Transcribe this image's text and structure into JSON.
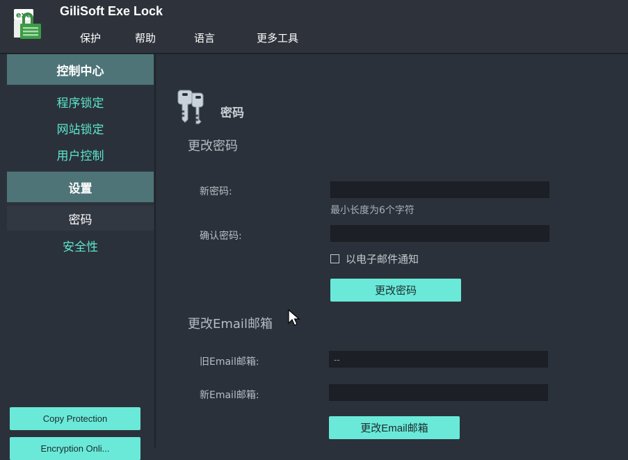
{
  "app": {
    "title": "GiliSoft Exe Lock",
    "logo_text": "exe"
  },
  "menu": {
    "items": [
      "保护",
      "帮助",
      "语言",
      "更多工具"
    ]
  },
  "sidebar": {
    "header_control": "控制中心",
    "control_items": [
      "程序锁定",
      "网站锁定",
      "用户控制"
    ],
    "header_settings": "设置",
    "settings_items": [
      "密码",
      "安全性"
    ],
    "bottom_buttons": [
      "Copy Protection",
      "Encryption Onli..."
    ]
  },
  "main": {
    "page_title": "密码",
    "password_section": {
      "title": "更改密码",
      "new_label": "新密码:",
      "new_value": "",
      "hint": "最小长度为6个字符",
      "confirm_label": "确认密码:",
      "confirm_value": "",
      "notify_label": "以电子邮件通知",
      "notify_checked": false,
      "button": "更改密码"
    },
    "email_section": {
      "title": "更改Email邮箱",
      "old_label": "旧Email邮箱:",
      "old_value": "--",
      "new_label": "新Email邮箱:",
      "new_value": "",
      "button": "更改Email邮箱"
    }
  },
  "colors": {
    "accent": "#6ae9d9",
    "sidebar_header": "#4e7478",
    "link": "#5ce6cf",
    "background": "#2b313a"
  }
}
